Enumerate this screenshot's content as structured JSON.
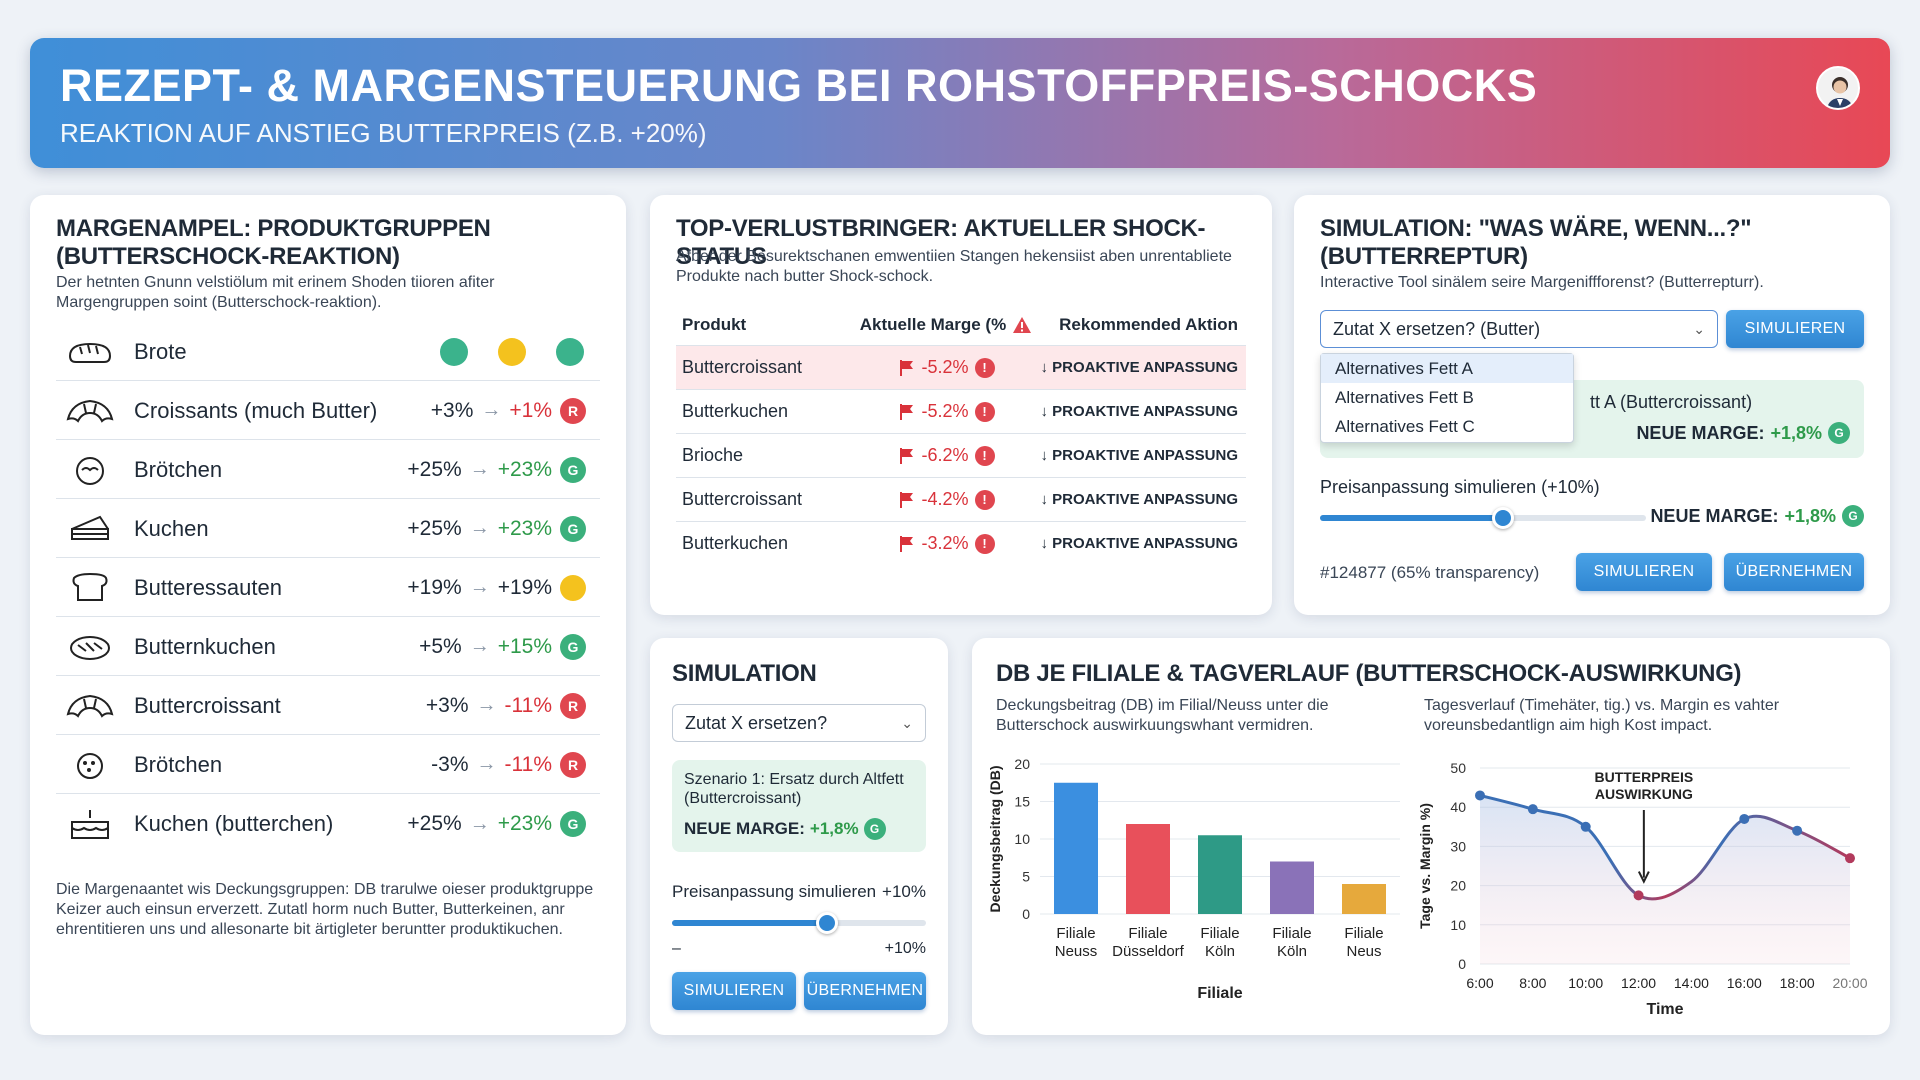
{
  "header": {
    "title": "REZEPT- & MARGENSTEUERUNG BEI ROHSTOFFPREIS-SCHOCKS",
    "subtitle": "REAKTION AUF ANSTIEG BUTTERPREIS (Z.B. +20%)"
  },
  "ampel": {
    "title": "MARGENAMPEL: PRODUKTGRUPPEN (BUTTERSCHOCK-REAKTION)",
    "subtitle": "Der hetnten Gnunn velstiölum mit erinem Shoden tiioren afiter Margengruppen soint (Butterschock-reaktion).",
    "first_row": {
      "name": "Brote",
      "dots": [
        "#3bb38c",
        "#f4c21e",
        "#3bb38c"
      ]
    },
    "rows": [
      {
        "name": "Croissants (much Butter)",
        "before": "+3%",
        "after": "+1%",
        "after_color": "neg",
        "status": "R"
      },
      {
        "name": "Brötchen",
        "before": "+25%",
        "after": "+23%",
        "after_color": "pos",
        "status": "G"
      },
      {
        "name": "Kuchen",
        "before": "+25%",
        "after": "+23%",
        "after_color": "pos",
        "status": "G"
      },
      {
        "name": "Butteressauten",
        "before": "+19%",
        "after": "+19%",
        "after_color": "plain",
        "status": "Y"
      },
      {
        "name": "Butternkuchen",
        "before": "+5%",
        "after": "+15%",
        "after_color": "pos",
        "status": "G"
      },
      {
        "name": "Buttercroissant",
        "before": "+3%",
        "after": "-11%",
        "after_color": "neg",
        "status": "R"
      },
      {
        "name": "Brötchen",
        "before": "-3%",
        "after": "-11%",
        "after_color": "neg",
        "status": "R"
      },
      {
        "name": "Kuchen (butterchen)",
        "before": "+25%",
        "after": "+23%",
        "after_color": "pos",
        "status": "G"
      }
    ],
    "icons": [
      "bread-icon",
      "croissant-icon",
      "roll-icon",
      "cake-icon",
      "toast-icon",
      "pie-icon",
      "croissant-icon",
      "bun-icon",
      "layer-cake-icon"
    ],
    "footnote": "Die Margenaantet wis Deckungsgruppen: DB trarulwe oieser produktgruppe Keizer auch einsun erverzett. Zutatl horm nuch Butter, Butterkeinen, anr ehrentitieren uns und allesonarte bit ärtigleter beruntter produktikuchen."
  },
  "verlust": {
    "title": "TOP-VERLUSTBRINGER: AKTUELLER SHOCK-STATUS",
    "subtitle": "Afber der Besurektschanen emwentiien Stangen hekensiist aben unrentabliete Produkte nach butter Shock-schock.",
    "headers": [
      "Produkt",
      "Aktuelle Marge (%",
      "Rekommended Aktion"
    ],
    "rows": [
      {
        "product": "Buttercroissant",
        "marge": "-5.2%",
        "action": "↓ PROAKTIVE ANPASSUNG"
      },
      {
        "product": "Butterkuchen",
        "marge": "-5.2%",
        "action": "↓ PROAKTIVE ANPASSUNG"
      },
      {
        "product": "Brioche",
        "marge": "-6.2%",
        "action": "↓ PROAKTIVE ANPASSUNG"
      },
      {
        "product": "Buttercroissant",
        "marge": "-4.2%",
        "action": "↓ PROAKTIVE ANPASSUNG"
      },
      {
        "product": "Butterkuchen",
        "marge": "-3.2%",
        "action": "↓ PROAKTIVE ANPASSUNG"
      }
    ]
  },
  "sim_tool": {
    "title": "SIMULATION: \"WAS WÄRE, WENN...?\" (BUTTERREPTUR)",
    "subtitle": "Interactive Tool sinälem seire Margeniffforenst? (Butterrepturr).",
    "select_value": "Zutat X ersetzen? (Butter)",
    "simulate_label": "SIMULIEREN",
    "menu_options": [
      "Alternatives Fett A",
      "Alternatives Fett B",
      "Alternatives Fett C"
    ],
    "scenario_text": "tt A (Buttercroissant)",
    "neue_marge_label": "NEUE MARGE:",
    "neue_marge_value": "+1,8%",
    "status": "G",
    "price_label": "Preisanpassung simulieren (+10%)",
    "slider_fraction": 0.56,
    "id_text": "#124877 (65% transparency)",
    "apply_label": "ÜBERNEHMEN"
  },
  "sim_small": {
    "title": "SIMULATION",
    "select_value": "Zutat X ersetzen?",
    "scenario_text": "Szenario 1: Ersatz durch Altfett (Buttercroissant)",
    "neue_marge_label": "NEUE MARGE:",
    "neue_marge_value": "+1,8%",
    "status": "G",
    "price_label": "Preisanpassung simulieren",
    "price_value": "+10%",
    "slider_fraction": 0.61,
    "range_min": "–",
    "range_max": "+10%",
    "simulate_label": "SIMULIEREN",
    "apply_label": "ÜBERNEHMEN"
  },
  "db": {
    "title": "DB JE FILIALE & TAGVERLAUF (BUTTERSCHOCK-AUSWIRKUNG)",
    "left_desc": "Deckungsbeitrag (DB) im Filial/Neuss unter die Butterschock auswirkuungswhant vermidren.",
    "right_desc": "Tagesverlauf (Timehäter, tig.) vs. Margin es vahter voreunsbedantlign aim high Kost impact."
  },
  "chart_data": [
    {
      "type": "bar",
      "categories": [
        "Filiale Neuss",
        "Filiale Düsseldorf",
        "Filiale Köln",
        "Filiale Köln",
        "Filiale Neus"
      ],
      "category_lines": [
        [
          "Filiale",
          "Neuss"
        ],
        [
          "Filiale",
          "Düsseldorf"
        ],
        [
          "Filiale",
          "Köln"
        ],
        [
          "Filiale",
          "Köln"
        ],
        [
          "Filiale",
          "Neus"
        ]
      ],
      "values": [
        17.5,
        12,
        10.5,
        7,
        4
      ],
      "colors": [
        "#3b8fe0",
        "#e8505b",
        "#2e9a86",
        "#8a72b8",
        "#e6a93c"
      ],
      "xlabel": "Filiale",
      "ylabel": "Deckungsbeitrag (DB)",
      "ylim": [
        0,
        20
      ],
      "yticks": [
        0,
        5,
        10,
        15,
        20
      ],
      "grid": true
    },
    {
      "type": "line",
      "x": [
        "6:00",
        "8:00",
        "10:00",
        "12:00",
        "14:00",
        "16:00",
        "18:00",
        "20:00"
      ],
      "points_x": [
        6,
        8,
        10,
        12,
        14,
        16,
        18,
        20
      ],
      "points_y": [
        43,
        39.5,
        35,
        17.5,
        21,
        37,
        34,
        27
      ],
      "marker_x": [
        6,
        8,
        10,
        12,
        16,
        18,
        20
      ],
      "marker_y": [
        43,
        39.5,
        35,
        17.5,
        37,
        34,
        27
      ],
      "xlabel": "Time",
      "ylabel": "Tage vs. Margin %)",
      "ylim": [
        0,
        50
      ],
      "yticks": [
        0,
        10,
        20,
        30,
        40,
        50
      ],
      "annotation": [
        "BUTTERPREIS",
        "AUSWIRKUNG"
      ],
      "annotation_x": 12.2,
      "line_colors": [
        "#3b6fb5",
        "#b23a5c"
      ],
      "grid": true
    }
  ]
}
